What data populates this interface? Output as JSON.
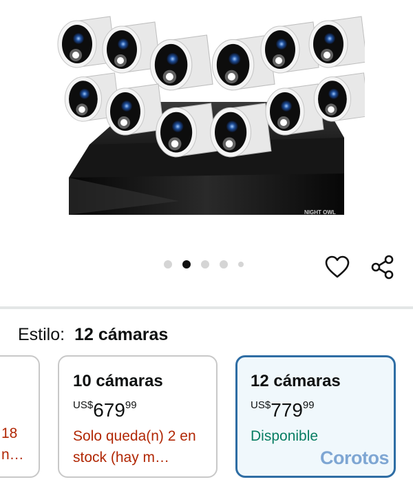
{
  "product": {
    "brand_mark": "NIGHT OWL",
    "image_alt": "Sistema de 12 cámaras de seguridad con grabador"
  },
  "carousel": {
    "dot_count": 5,
    "active_index": 1
  },
  "actions": {
    "favorite_icon": "heart-outline-icon",
    "share_icon": "share-icon"
  },
  "style_selector": {
    "label": "Estilo:",
    "selected": "12 cámaras"
  },
  "options": [
    {
      "partial_lines": [
        "18",
        "n…"
      ]
    },
    {
      "title": "10 cámaras",
      "currency": "US$",
      "whole": "679",
      "cents": "99",
      "status": "Solo queda(n) 2 en stock (hay m…"
    },
    {
      "title": "12 cámaras",
      "currency": "US$",
      "whole": "779",
      "cents": "99",
      "status": "Disponible"
    }
  ],
  "watermark": "Corotos",
  "colors": {
    "selected_border": "#2e6da4",
    "selected_bg": "#f0f8fc",
    "stock_warning": "#b12704",
    "available": "#067d62"
  }
}
